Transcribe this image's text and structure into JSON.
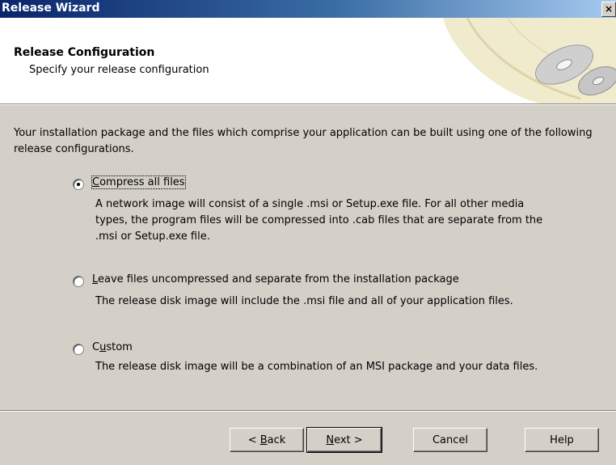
{
  "window": {
    "title": "Release Wizard",
    "close_glyph": "×"
  },
  "header": {
    "title": "Release Configuration",
    "subtitle": "Specify your release configuration",
    "art_icon": "cd-disc-icon"
  },
  "intro": "Your installation package and the files which comprise your application can be built using one of the following release configurations.",
  "options": [
    {
      "label_pre": "",
      "label_key": "C",
      "label_post": "ompress all files",
      "selected": true,
      "desc_lines": [
        "A network image will consist of a single .msi or Setup.exe file. For all other media",
        "types, the program files will be compressed into .cab files that are separate from the",
        ".msi or Setup.exe file."
      ]
    },
    {
      "label_pre": "",
      "label_key": "L",
      "label_post": "eave files uncompressed and separate from the installation package",
      "selected": false,
      "desc_lines": [
        "The release disk image will include the .msi file and all of your application files."
      ]
    },
    {
      "label_pre": "C",
      "label_key": "u",
      "label_post": "stom",
      "selected": false,
      "desc_lines": [
        "The release disk image will be a combination of an MSI package and your data files."
      ]
    }
  ],
  "buttons": {
    "back": {
      "pre": "< ",
      "key": "B",
      "post": "ack"
    },
    "next": {
      "pre": "",
      "key": "N",
      "post": "ext >"
    },
    "cancel": "Cancel",
    "help": "Help"
  }
}
